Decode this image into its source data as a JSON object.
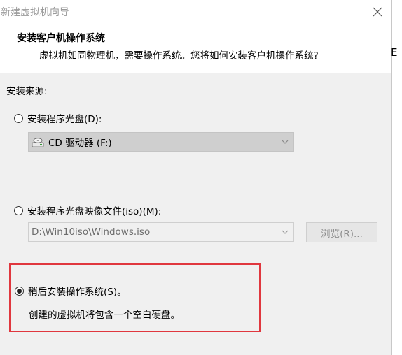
{
  "window": {
    "title": "新建虚拟机向导"
  },
  "header": {
    "title": "安装客户机操作系统",
    "subtitle": "虚拟机如同物理机，需要操作系统。您将如何安装客户机操作系统?"
  },
  "right_edge_char": "E",
  "install_source": {
    "label": "安装来源:",
    "disc_option": {
      "label": "安装程序光盘(D):",
      "selected": false,
      "drive": "CD 驱动器 (F:)"
    },
    "iso_option": {
      "label": "安装程序光盘映像文件(iso)(M):",
      "selected": false,
      "path": "D:\\Win10iso\\Windows.iso",
      "browse_label": "浏览(R)..."
    },
    "later_option": {
      "label": "稍后安装操作系统(S)。",
      "selected": true,
      "description": "创建的虚拟机将包含一个空白硬盘。"
    }
  },
  "colors": {
    "highlight": "#e0373e",
    "panel_bg": "#f0f0f0"
  },
  "icons": [
    "close-icon",
    "cd-drive-icon",
    "chevron-down-icon"
  ]
}
